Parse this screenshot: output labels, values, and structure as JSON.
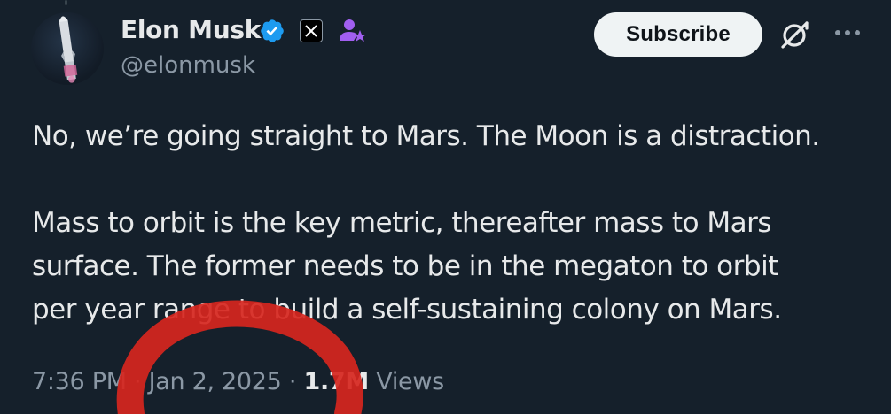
{
  "author": {
    "display_name": "Elon Musk",
    "handle": "@elonmusk",
    "verified": true,
    "badges": [
      "verified-icon",
      "x-logo-icon",
      "affiliate-icon"
    ]
  },
  "actions": {
    "subscribe_label": "Subscribe",
    "grok_icon": "grok-icon",
    "more_icon": "more-icon"
  },
  "tweet": {
    "paragraphs": [
      "No, we’re going straight to Mars. The Moon is a distraction.",
      [
        "Mass to orbit is the key metric, thereafter mass to Mars",
        "surface. The former needs to be in the megaton to orbit",
        "per year range to build a self-sustaining colony on Mars."
      ]
    ],
    "line1": "No, we’re going straight to Mars. The Moon is a distraction.",
    "line2": "Mass to orbit is the key metric, thereafter mass to Mars",
    "line3": "surface. The former needs to be in the megaton to orbit",
    "line4": "per year range to build a self-sustaining colony on Mars."
  },
  "meta": {
    "time": "7:36 PM",
    "separator": "·",
    "date": "Jan 2, 2025",
    "views_count": "1.7M",
    "views_label": "Views"
  },
  "colors": {
    "background": "#15202b",
    "text_primary": "#e7e9ea",
    "text_secondary": "#8b98a5",
    "verified_blue": "#1d9bf0",
    "affiliate_purple": "#a15ff0",
    "annotation_red": "#d7261e",
    "subscribe_bg": "#eff3f4"
  }
}
